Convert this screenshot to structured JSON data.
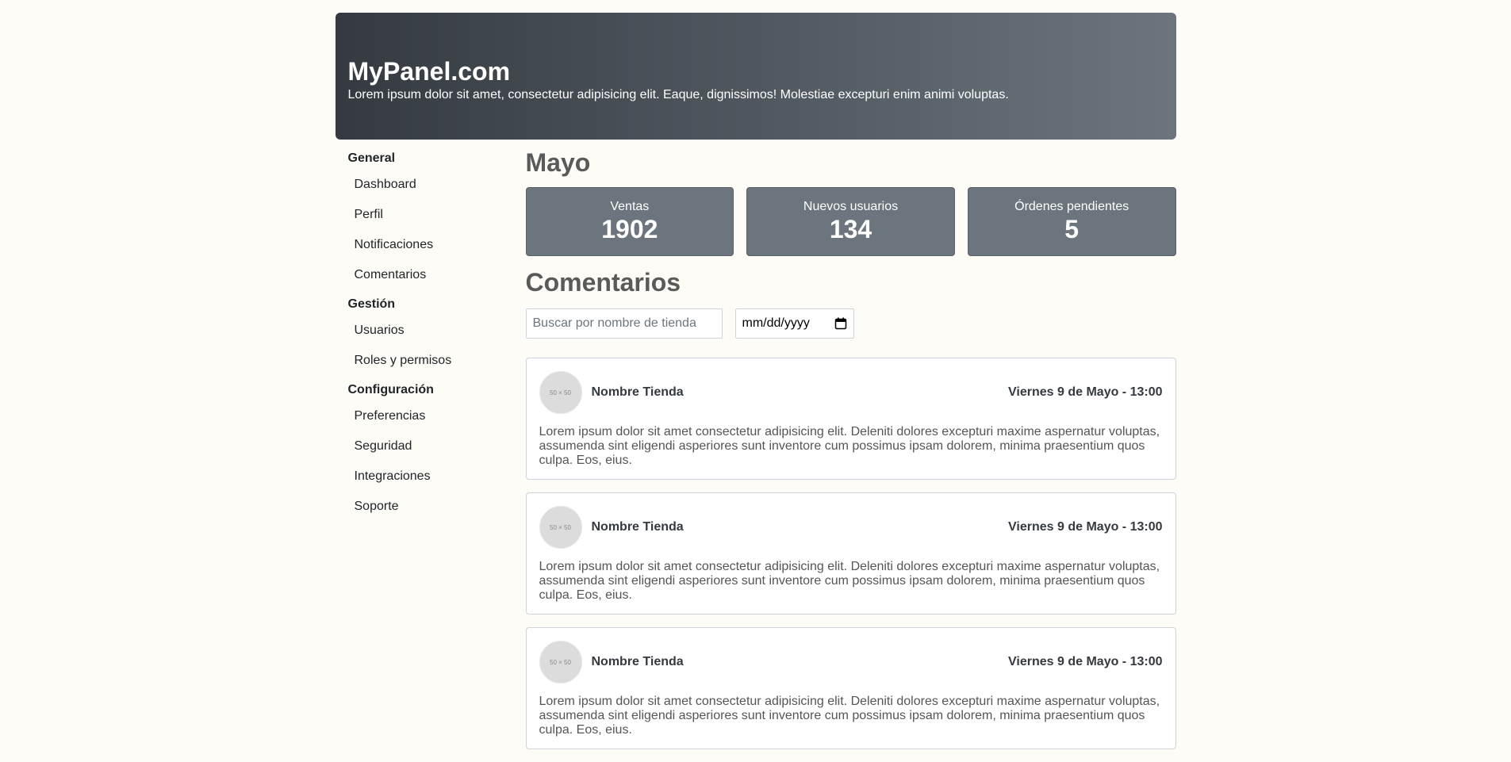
{
  "header": {
    "title": "MyPanel.com",
    "subtitle": "Lorem ipsum dolor sit amet, consectetur adipisicing elit. Eaque, dignissimos! Molestiae excepturi enim animi voluptas."
  },
  "sidebar": {
    "groups": [
      {
        "title": "General",
        "items": [
          "Dashboard",
          "Perfil",
          "Notificaciones",
          "Comentarios"
        ]
      },
      {
        "title": "Gestión",
        "items": [
          "Usuarios",
          "Roles y permisos"
        ]
      },
      {
        "title": "Configuración",
        "items": [
          "Preferencias",
          "Seguridad",
          "Integraciones",
          "Soporte"
        ]
      }
    ]
  },
  "main": {
    "month_title": "Mayo",
    "stats": [
      {
        "label": "Ventas",
        "value": "1902"
      },
      {
        "label": "Nuevos usuarios",
        "value": "134"
      },
      {
        "label": "Órdenes pendientes",
        "value": "5"
      }
    ],
    "comments_title": "Comentarios",
    "search_placeholder": "Buscar por nombre de tienda",
    "date_placeholder": "mm/dd/yyyy",
    "comments": [
      {
        "avatar_text": "50 × 50",
        "store": "Nombre Tienda",
        "date": "Viernes 9 de Mayo - 13:00",
        "body": "Lorem ipsum dolor sit amet consectetur adipisicing elit. Deleniti dolores excepturi maxime aspernatur voluptas, assumenda sint eligendi asperiores sunt inventore cum possimus ipsam dolorem, minima praesentium quos culpa. Eos, eius."
      },
      {
        "avatar_text": "50 × 50",
        "store": "Nombre Tienda",
        "date": "Viernes 9 de Mayo - 13:00",
        "body": "Lorem ipsum dolor sit amet consectetur adipisicing elit. Deleniti dolores excepturi maxime aspernatur voluptas, assumenda sint eligendi asperiores sunt inventore cum possimus ipsam dolorem, minima praesentium quos culpa. Eos, eius."
      },
      {
        "avatar_text": "50 × 50",
        "store": "Nombre Tienda",
        "date": "Viernes 9 de Mayo - 13:00",
        "body": "Lorem ipsum dolor sit amet consectetur adipisicing elit. Deleniti dolores excepturi maxime aspernatur voluptas, assumenda sint eligendi asperiores sunt inventore cum possimus ipsam dolorem, minima praesentium quos culpa. Eos, eius."
      }
    ]
  }
}
